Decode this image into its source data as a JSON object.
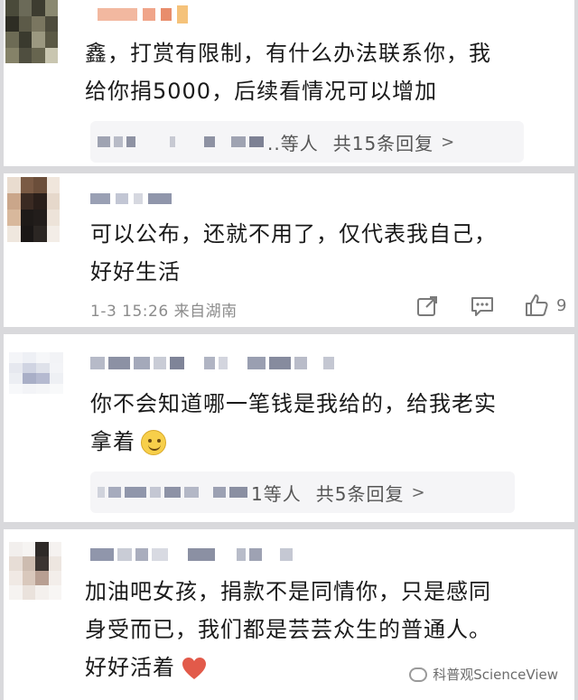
{
  "comments": [
    {
      "content_line1": "鑫，打赏有限制，有什么办法联系你，我",
      "content_line2": "给你捐5000，后续看情况可以增加",
      "replies": {
        "name_tail": "..等人",
        "summary": "共15条回复",
        "chevron": ">"
      }
    },
    {
      "content_line1": "可以公布，还就不用了，仅代表我自己，",
      "content_line2": "好好生活",
      "meta": "1-3 15:26 来自湖南",
      "actions": {
        "share_icon": "share-icon",
        "comment_icon": "comment-icon",
        "like_icon": "thumbs-up-icon",
        "like_count": "9"
      }
    },
    {
      "content_line1": "你不会知道哪一笔钱是我给的，给我老实",
      "content_line2": "拿着",
      "emoji": "smile-emoji",
      "replies": {
        "name_tail": "1等人",
        "summary": "共5条回复",
        "chevron": ">"
      }
    },
    {
      "content_line1": "加油吧女孩，捐款不是同情你，只是感同",
      "content_line2": "身受而已，我们都是芸芸众生的普通人。",
      "content_line3": "好好活着",
      "emoji": "red-heart-emoji"
    }
  ],
  "watermark": "科普观ScienceView",
  "colors": {
    "background": "#d9d9dc",
    "card": "#ffffff",
    "meta_text": "#8c8c8c",
    "reply_bg": "#f5f5f7",
    "heart": "#e25a4a"
  }
}
